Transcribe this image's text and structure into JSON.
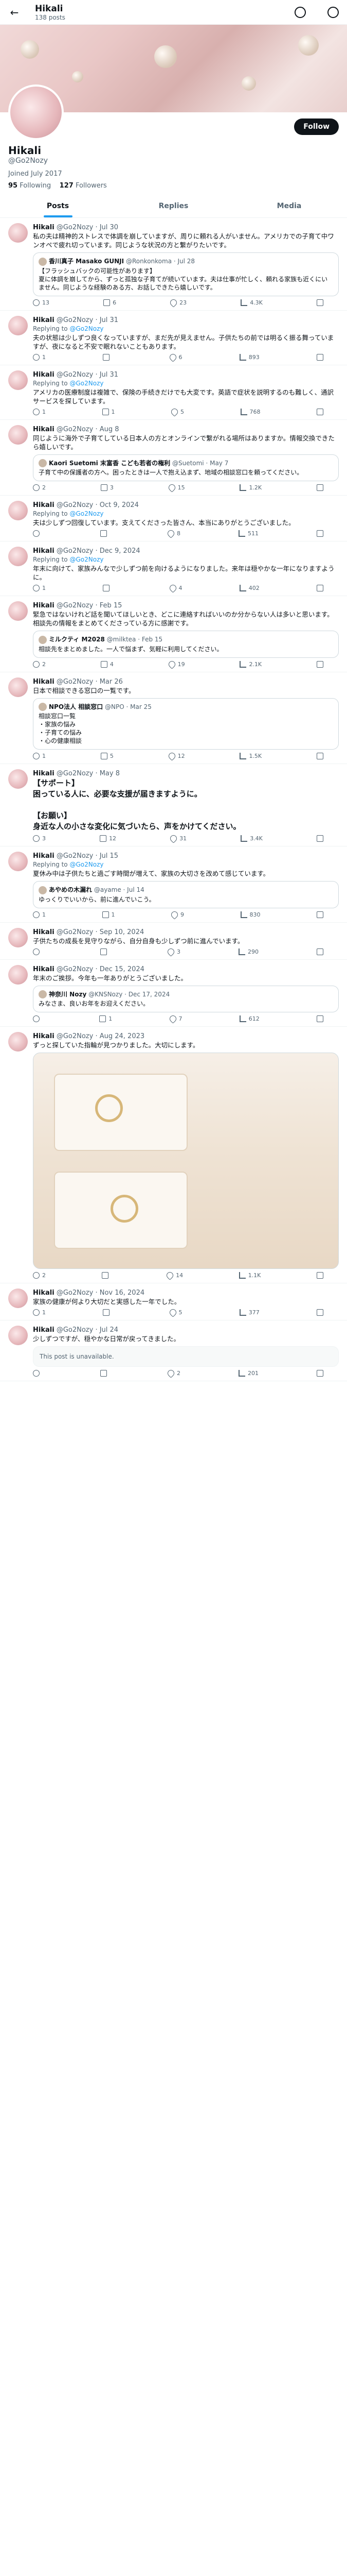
{
  "header": {
    "back": "←",
    "name": "Hikali",
    "post_count": "138 posts"
  },
  "profile": {
    "follow_label": "Follow",
    "name": "Hikali",
    "handle": "@Go2Nozy",
    "joined": "Joined July 2017",
    "following_count": "95",
    "following_label": "Following",
    "followers_count": "127",
    "followers_label": "Followers"
  },
  "tabs": [
    {
      "label": "Posts"
    },
    {
      "label": "Replies"
    },
    {
      "label": "Media"
    }
  ],
  "tweets": [
    {
      "name": "Hikali",
      "handle": "@Go2Nozy",
      "date": "Jul 30",
      "text": "私の夫は精神的ストレスで体調を崩していますが、周りに頼れる人がいません。アメリカでの子育て中ワンオペで疲れ切っています。同じような状況の方と繋がりたいです。",
      "quote": {
        "name": "香川真子 Masako GUNJI",
        "handle": "@Ronkonkoma · Jul 28",
        "text": "【フラッシュバックの可能性があります】\n夏に体調を崩してから、ずっと孤独な子育てが続いています。夫は仕事が忙しく、頼れる家族も近くにいません。同じような経験のある方、お話しできたら嬉しいです。"
      },
      "replies": "13",
      "reposts": "6",
      "likes": "23",
      "views": "4.3K"
    },
    {
      "name": "Hikali",
      "handle": "@Go2Nozy",
      "date": "Jul 31",
      "reply_to": "@Go2Nozy",
      "text": "夫の状態は少しずつ良くなっていますが、まだ先が見えません。子供たちの前では明るく振る舞っていますが、夜になると不安で眠れないこともあります。",
      "replies": "1",
      "reposts": "",
      "likes": "6",
      "views": "893"
    },
    {
      "name": "Hikali",
      "handle": "@Go2Nozy",
      "date": "Jul 31",
      "reply_to": "@Go2Nozy",
      "text": "アメリカの医療制度は複雑で、保険の手続きだけでも大変です。英語で症状を説明するのも難しく、通訳サービスを探しています。",
      "replies": "1",
      "reposts": "1",
      "likes": "5",
      "views": "768"
    },
    {
      "name": "Hikali",
      "handle": "@Go2Nozy",
      "date": "Aug 8",
      "text": "同じように海外で子育てしている日本人の方とオンラインで繋がれる場所はありますか。情報交換できたら嬉しいです。",
      "quote": {
        "name": "Kaori Suetomi 末富香 こども若者の権利",
        "handle": "@Suetomi · May 7",
        "text": "子育て中の保護者の方へ。困ったときは一人で抱え込まず、地域の相談窓口を頼ってください。"
      },
      "replies": "2",
      "reposts": "3",
      "likes": "15",
      "views": "1.2K"
    },
    {
      "name": "Hikali",
      "handle": "@Go2Nozy",
      "date": "Oct 9, 2024",
      "reply_to": "@Go2Nozy",
      "text": "夫は少しずつ回復しています。支えてくださった皆さん、本当にありがとうございました。",
      "replies": "",
      "reposts": "",
      "likes": "8",
      "views": "511"
    },
    {
      "name": "Hikali",
      "handle": "@Go2Nozy",
      "date": "Dec 9, 2024",
      "reply_to": "@Go2Nozy",
      "text": "年末に向けて、家族みんなで少しずつ前を向けるようになりました。来年は穏やかな一年になりますように。",
      "replies": "1",
      "reposts": "",
      "likes": "4",
      "views": "402"
    },
    {
      "name": "Hikali",
      "handle": "@Go2Nozy",
      "date": "Feb 15",
      "text": "緊急ではないけれど話を聞いてほしいとき、どこに連絡すればいいのか分からない人は多いと思います。相談先の情報をまとめてくださっている方に感謝です。",
      "quote": {
        "name": "ミルクティ M2028",
        "handle": "@milktea · Feb 15",
        "text": "相談先をまとめました。一人で悩まず、気軽に利用してください。"
      },
      "replies": "2",
      "reposts": "4",
      "likes": "19",
      "views": "2.1K"
    },
    {
      "name": "Hikali",
      "handle": "@Go2Nozy",
      "date": "Mar 26",
      "text": "日本で相談できる窓口の一覧です。",
      "quote": {
        "name": "NPO法人 相談窓口",
        "handle": "@NPO · Mar 25",
        "text": "相談窓口一覧\n・家族の悩み\n・子育ての悩み\n・心の健康相談"
      },
      "replies": "1",
      "reposts": "5",
      "likes": "12",
      "views": "1.5K"
    },
    {
      "name": "Hikali",
      "handle": "@Go2Nozy",
      "date": "May 8",
      "text": "【サポート】\n困っている人に、必要な支援が届きますように。\n\n【お願い】\n身近な人の小さな変化に気づいたら、声をかけてください。",
      "big": true,
      "replies": "3",
      "reposts": "12",
      "likes": "31",
      "views": "3.4K"
    },
    {
      "name": "Hikali",
      "handle": "@Go2Nozy",
      "date": "Jul 15",
      "reply_to": "@Go2Nozy",
      "text": "夏休み中は子供たちと過ごす時間が増えて、家族の大切さを改めて感じています。",
      "quote": {
        "name": "あやめの木漏れ",
        "handle": "@ayame · Jul 14",
        "text": "ゆっくりでいいから、前に進んでいこう。"
      },
      "replies": "1",
      "reposts": "1",
      "likes": "9",
      "views": "830"
    },
    {
      "name": "Hikali",
      "handle": "@Go2Nozy",
      "date": "Sep 10, 2024",
      "text": "子供たちの成長を見守りながら、自分自身も少しずつ前に進んでいます。",
      "replies": "",
      "reposts": "",
      "likes": "3",
      "views": "290"
    },
    {
      "name": "Hikali",
      "handle": "@Go2Nozy",
      "date": "Dec 15, 2024",
      "text": "年末のご挨拶。今年も一年ありがとうございました。",
      "quote": {
        "name": "神奈川 Nozy",
        "handle": "@KNSNozy · Dec 17, 2024",
        "text": "みなさま、良いお年をお迎えください。"
      },
      "replies": "",
      "reposts": "1",
      "likes": "7",
      "views": "612"
    },
    {
      "name": "Hikali",
      "handle": "@Go2Nozy",
      "date": "Aug 24, 2023",
      "text": "ずっと探していた指輪が見つかりました。大切にします。",
      "has_media": true,
      "replies": "2",
      "reposts": "",
      "likes": "14",
      "views": "1.1K"
    },
    {
      "name": "Hikali",
      "handle": "@Go2Nozy",
      "date": "Nov 16, 2024",
      "text": "家族の健康が何より大切だと実感した一年でした。",
      "replies": "1",
      "reposts": "",
      "likes": "5",
      "views": "377"
    },
    {
      "name": "Hikali",
      "handle": "@Go2Nozy",
      "date": "Jul 24",
      "text": "少しずつですが、穏やかな日常が戻ってきました。",
      "unavailable": "This post is unavailable.",
      "replies": "",
      "reposts": "",
      "likes": "2",
      "views": "201"
    }
  ]
}
